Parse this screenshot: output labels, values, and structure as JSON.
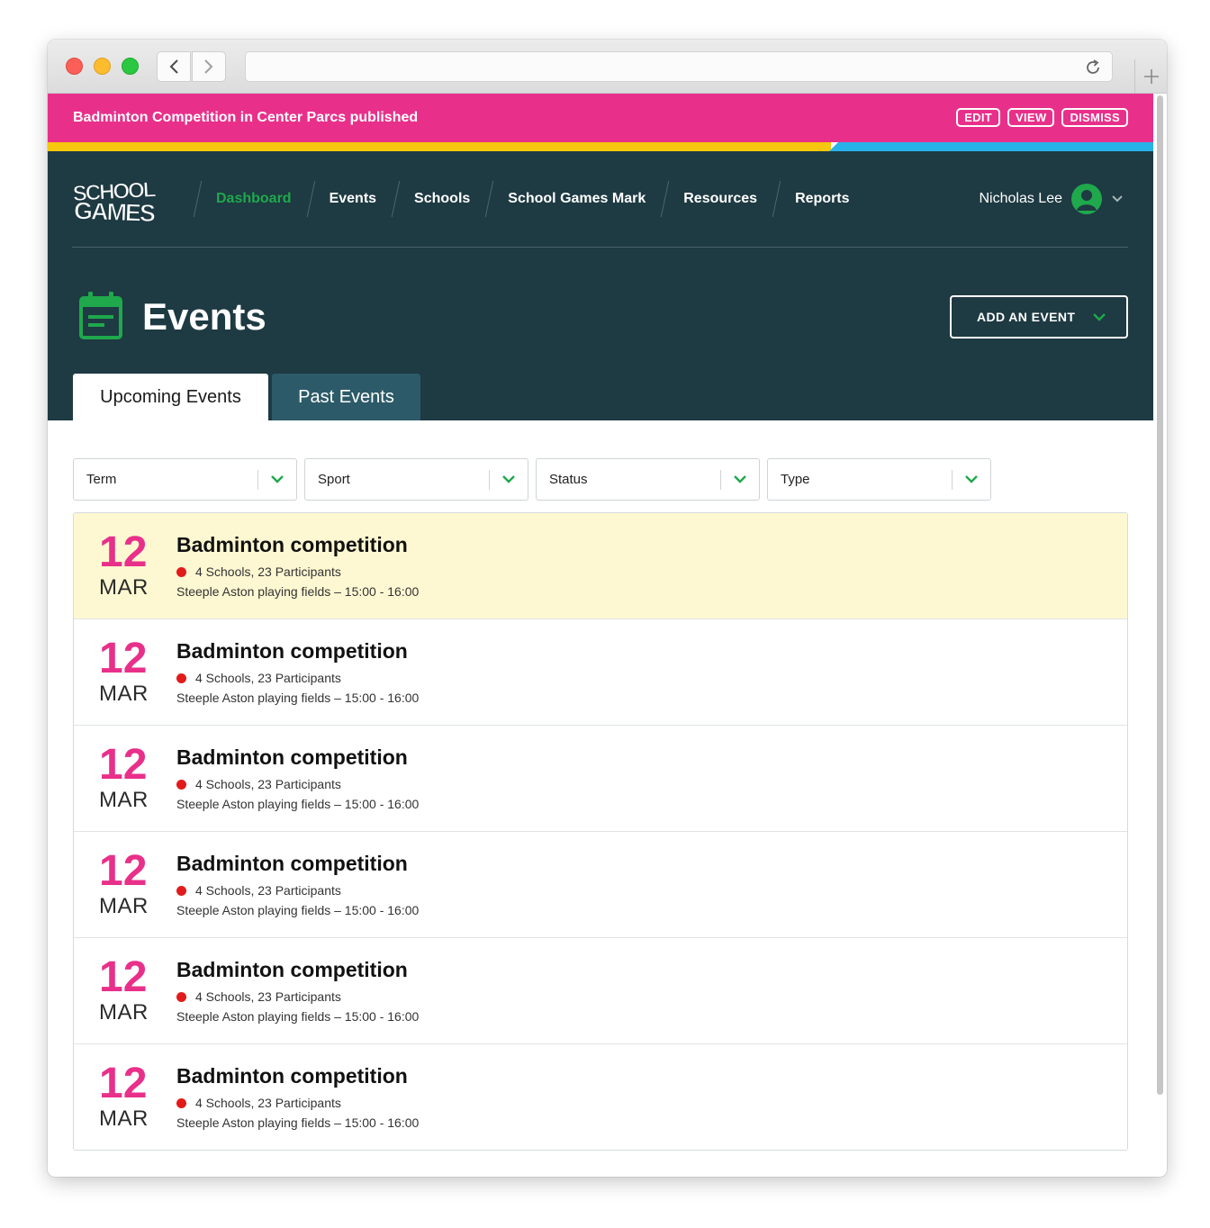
{
  "notification": {
    "message": "Badminton Competition in Center Parcs published",
    "actions": [
      "EDIT",
      "VIEW",
      "DISMISS"
    ]
  },
  "colors": {
    "brand_pink": "#e8308a",
    "header_bg": "#1e3a42",
    "accent_green": "#1fa84c",
    "stripe_yellow": "#f6c70e",
    "stripe_blue": "#27b3e8",
    "highlight_row": "#fef8d2",
    "status_red": "#e11b1b"
  },
  "logo": {
    "icon": "school-games-logo",
    "text": "SCHOOL GAMES"
  },
  "nav": {
    "items": [
      {
        "label": "Dashboard",
        "active": true
      },
      {
        "label": "Events",
        "active": false
      },
      {
        "label": "Schools",
        "active": false
      },
      {
        "label": "School Games Mark",
        "active": false
      },
      {
        "label": "Resources",
        "active": false
      },
      {
        "label": "Reports",
        "active": false
      }
    ],
    "user_name": "Nicholas Lee"
  },
  "page": {
    "title": "Events",
    "icon": "calendar-icon",
    "add_button": "ADD AN EVENT"
  },
  "tabs": [
    {
      "label": "Upcoming Events",
      "active": true
    },
    {
      "label": "Past Events",
      "active": false
    }
  ],
  "filters": [
    {
      "label": "Term"
    },
    {
      "label": "Sport"
    },
    {
      "label": "Status"
    },
    {
      "label": "Type"
    }
  ],
  "events": [
    {
      "day": "12",
      "month": "MAR",
      "title": "Badminton competition",
      "meta": "4 Schools, 23 Participants",
      "location": "Steeple Aston playing fields – 15:00 - 16:00",
      "highlight": true
    },
    {
      "day": "12",
      "month": "MAR",
      "title": "Badminton competition",
      "meta": "4 Schools, 23 Participants",
      "location": "Steeple Aston playing fields – 15:00 - 16:00",
      "highlight": false
    },
    {
      "day": "12",
      "month": "MAR",
      "title": "Badminton competition",
      "meta": "4 Schools, 23 Participants",
      "location": "Steeple Aston playing fields – 15:00 - 16:00",
      "highlight": false
    },
    {
      "day": "12",
      "month": "MAR",
      "title": "Badminton competition",
      "meta": "4 Schools, 23 Participants",
      "location": "Steeple Aston playing fields – 15:00 - 16:00",
      "highlight": false
    },
    {
      "day": "12",
      "month": "MAR",
      "title": "Badminton competition",
      "meta": "4 Schools, 23 Participants",
      "location": "Steeple Aston playing fields – 15:00 - 16:00",
      "highlight": false
    },
    {
      "day": "12",
      "month": "MAR",
      "title": "Badminton competition",
      "meta": "4 Schools, 23 Participants",
      "location": "Steeple Aston playing fields – 15:00 - 16:00",
      "highlight": false
    }
  ]
}
